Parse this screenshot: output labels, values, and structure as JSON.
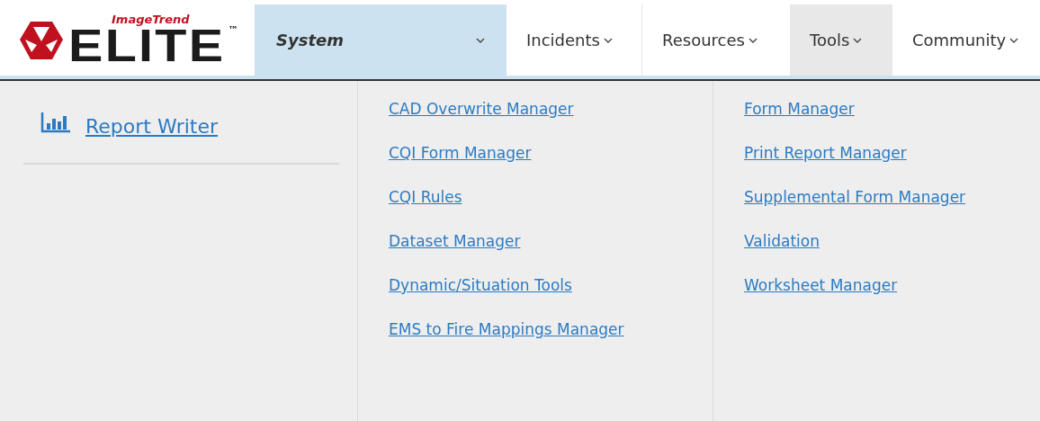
{
  "logo": {
    "brand": "ImageTrend",
    "product": "ELITE",
    "mark": "™"
  },
  "nav": [
    {
      "label": "System",
      "selected": true,
      "open": false
    },
    {
      "label": "Incidents",
      "selected": false,
      "open": false
    },
    {
      "label": "Resources",
      "selected": false,
      "open": false
    },
    {
      "label": "Tools",
      "selected": false,
      "open": true
    },
    {
      "label": "Community",
      "selected": false,
      "open": false
    }
  ],
  "menu": {
    "featured": {
      "label": "Report Writer"
    },
    "columns": [
      [
        "CAD Overwrite Manager",
        "CQI Form Manager",
        "CQI Rules",
        "Dataset Manager",
        "Dynamic/Situation Tools",
        "EMS to Fire Mappings Manager"
      ],
      [
        "Form Manager",
        "Print Report Manager",
        "Supplemental Form Manager",
        "Validation",
        "Worksheet Manager"
      ]
    ]
  }
}
